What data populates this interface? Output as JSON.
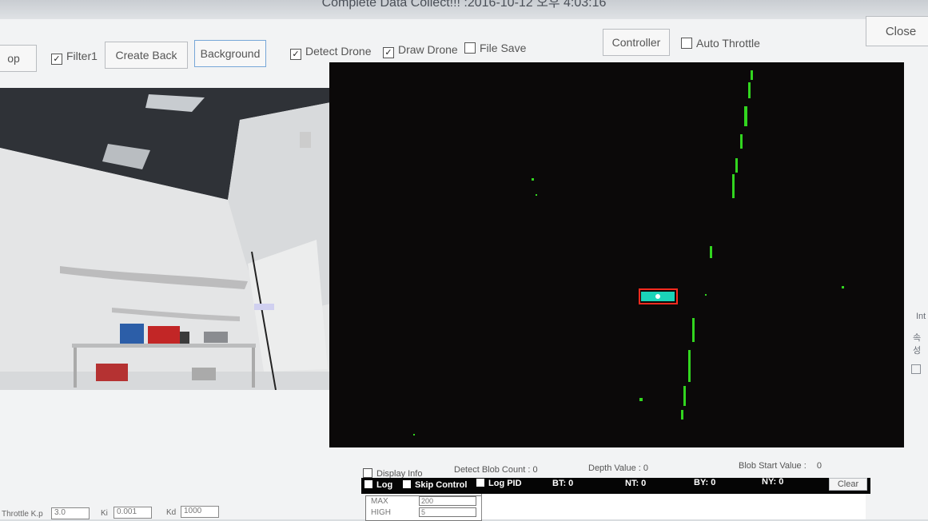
{
  "window": {
    "title": "Complete Data Collect!!! :2016-10-12 오후 4:03:16"
  },
  "toolbar": {
    "stop_label": "op",
    "filter_label": "Filter1",
    "filter_checked": true,
    "create_back_label": "Create Back",
    "background_label": "Background",
    "detect_drone_label": "Detect Drone",
    "detect_drone_checked": true,
    "draw_drone_label": "Draw Drone",
    "draw_drone_checked": true,
    "file_save_label": "File Save",
    "file_save_checked": false,
    "controller_label": "Controller",
    "auto_throttle_label": "Auto Throttle",
    "auto_throttle_checked": false,
    "close_label": "Close"
  },
  "depth_view": {
    "background_color": "#0b0909",
    "detection_box_color": "#ff2b1f",
    "detection_fill_color": "#1bd4b9",
    "points_color": "#32d51f"
  },
  "info_row": {
    "display_info_label": "Display Info",
    "display_info_checked": false,
    "detect_blob_count_label": "Detect Blob Count :",
    "detect_blob_count_value": "0",
    "depth_value_label": "Depth Value :",
    "depth_value": "0",
    "blob_start_value_label": "Blob Start Value :",
    "blob_start_value": "0"
  },
  "log_panel": {
    "log_label": "Log",
    "skip_control_label": "Skip Control",
    "log_pid_label": "Log PID",
    "bt_label": "BT:",
    "bt_value": "0",
    "nt_label": "NT:",
    "nt_value": "0",
    "by_label": "BY:",
    "by_value": "0",
    "ny_label": "NY:",
    "ny_value": "0",
    "clear_label": "Clear",
    "table": [
      {
        "key": "MAX",
        "value": "200"
      },
      {
        "key": "HIGH",
        "value": "5"
      }
    ]
  },
  "pid": {
    "throttle_kp_label": "Throttle K.p",
    "throttle_kp_value": "3.0",
    "ki_label": "Ki",
    "ki_value": "0.001",
    "kd_label": "Kd",
    "kd_value": "1000"
  },
  "side": {
    "int_label": "Int",
    "ko_label": "속성"
  }
}
